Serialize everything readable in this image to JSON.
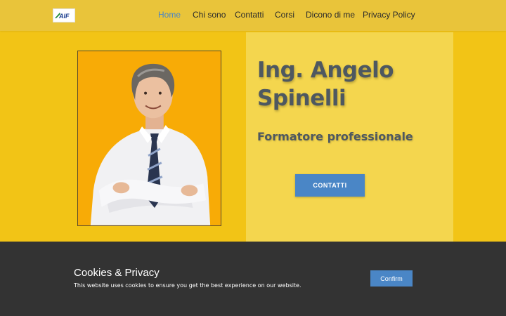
{
  "header": {
    "logo_text": "AIF",
    "nav": [
      {
        "label": "Home",
        "active": true
      },
      {
        "label": "Chi sono",
        "active": false
      },
      {
        "label": "Contatti",
        "active": false
      },
      {
        "label": "Corsi",
        "active": false
      },
      {
        "label": "Dicono di me",
        "active": false
      },
      {
        "label": "Privacy Policy",
        "active": false
      }
    ]
  },
  "hero": {
    "title": "Ing. Angelo Spinelli",
    "subtitle": "Formatore professionale",
    "button_label": "CONTATTI",
    "photo_icon": "portrait-photo"
  },
  "cookie_bar": {
    "title": "Cookies & Privacy",
    "text": "This website uses cookies to ensure you get the best experience on our website.",
    "button_label": "Confirm"
  },
  "colors": {
    "page_background": "#f2c416",
    "header_background": "#e9c43a",
    "hero_panel": "#f4d64e",
    "photo_background": "#f8ab06",
    "accent_blue": "#4a86c6",
    "heading_text": "#4e5860",
    "cookie_background": "#333333"
  }
}
